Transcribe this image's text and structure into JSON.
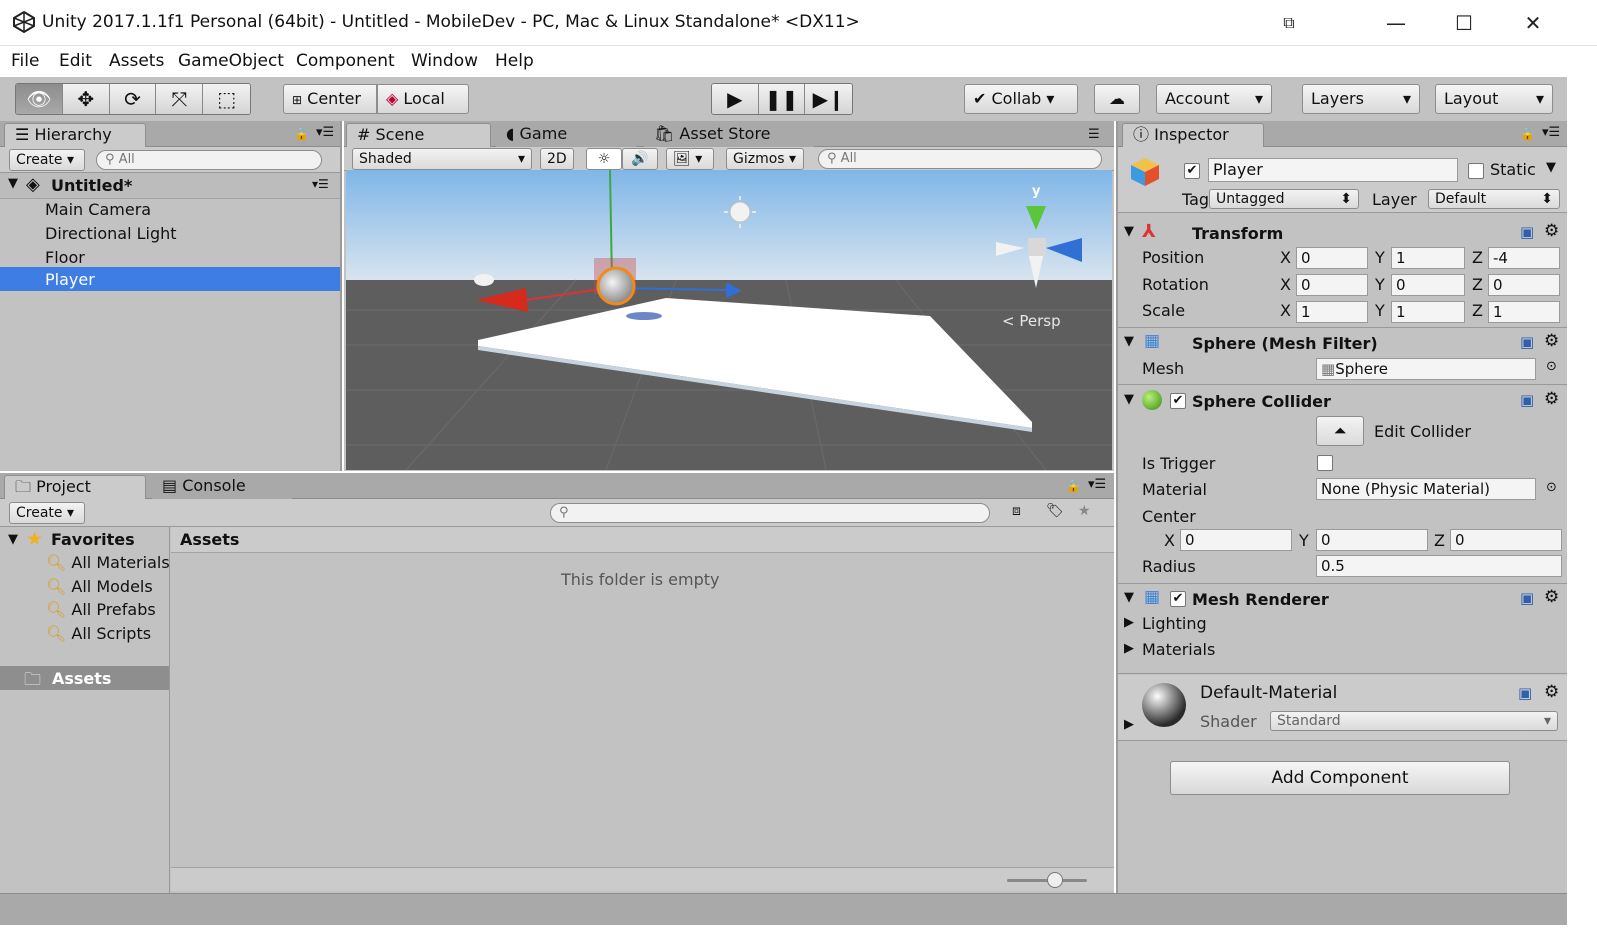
{
  "window": {
    "title": "Unity 2017.1.1f1 Personal (64bit) - Untitled - MobileDev - PC, Mac & Linux Standalone* <DX11>"
  },
  "menu": [
    "File",
    "Edit",
    "Assets",
    "GameObject",
    "Component",
    "Window",
    "Help"
  ],
  "toolbar": {
    "pivot": "Center",
    "space": "Local",
    "collab": "Collab",
    "account": "Account",
    "layers": "Layers",
    "layout": "Layout"
  },
  "hierarchy": {
    "tab": "Hierarchy",
    "create": "Create",
    "search": "All",
    "scene": "Untitled*",
    "items": [
      "Main Camera",
      "Directional Light",
      "Floor",
      "Player"
    ],
    "selected": "Player"
  },
  "scene_tabs": {
    "scene": "Scene",
    "game": "Game",
    "asset_store": "Asset Store"
  },
  "scene_bar": {
    "shading": "Shaded",
    "mode2d": "2D",
    "gizmos": "Gizmos",
    "search": "All",
    "persp": "Persp"
  },
  "project": {
    "tab": "Project",
    "console_tab": "Console",
    "create": "Create",
    "favorites": "Favorites",
    "favorite_items": [
      "All Materials",
      "All Models",
      "All Prefabs",
      "All Scripts"
    ],
    "assets_folder": "Assets",
    "breadcrumb": "Assets",
    "empty_msg": "This folder is empty"
  },
  "inspector": {
    "tab": "Inspector",
    "name": "Player",
    "static": "Static",
    "tag_label": "Tag",
    "tag": "Untagged",
    "layer_label": "Layer",
    "layer": "Default",
    "transform": {
      "title": "Transform",
      "position_label": "Position",
      "position": [
        "0",
        "1",
        "-4"
      ],
      "rotation_label": "Rotation",
      "rotation": [
        "0",
        "0",
        "0"
      ],
      "scale_label": "Scale",
      "scale": [
        "1",
        "1",
        "1"
      ]
    },
    "axes": [
      "X",
      "Y",
      "Z"
    ],
    "mesh_filter": {
      "title": "Sphere (Mesh Filter)",
      "mesh_label": "Mesh",
      "mesh": "Sphere"
    },
    "collider": {
      "title": "Sphere Collider",
      "edit": "Edit Collider",
      "trigger_label": "Is Trigger",
      "material_label": "Material",
      "material": "None (Physic Material)",
      "center_label": "Center",
      "center": [
        "0",
        "0",
        "0"
      ],
      "radius_label": "Radius",
      "radius": "0.5"
    },
    "renderer": {
      "title": "Mesh Renderer",
      "lighting": "Lighting",
      "materials": "Materials"
    },
    "material": {
      "name": "Default-Material",
      "shader_label": "Shader",
      "shader": "Standard"
    },
    "add_component": "Add Component"
  }
}
